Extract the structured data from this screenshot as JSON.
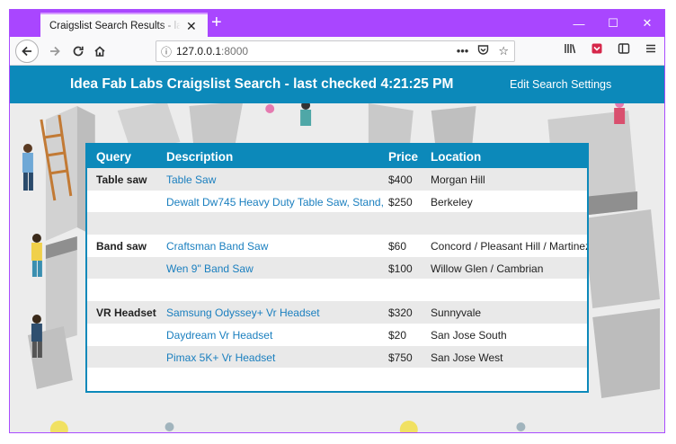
{
  "browser": {
    "tab_title": "Craigslist Search Results - last checked",
    "tab_close": "✕",
    "new_tab": "+",
    "url_host": "127.0.0.1",
    "url_port": ":8000",
    "window_controls": [
      "—",
      "☐",
      "✕"
    ]
  },
  "header": {
    "title": "Idea Fab Labs Craigslist Search - last checked 4:21:25 PM",
    "edit_link": "Edit Search Settings",
    "color": "#0c89ba"
  },
  "table": {
    "columns": [
      "Query",
      "Description",
      "Price",
      "Location"
    ],
    "rows": [
      {
        "query": "Table saw",
        "description": "Table Saw",
        "price": "$400",
        "location": "Morgan Hill"
      },
      {
        "query": "",
        "description": "Dewalt Dw745 Heavy Duty Table Saw, Stand,",
        "price": "$250",
        "location": "Berkeley"
      },
      {
        "query": "",
        "description": "",
        "price": "",
        "location": ""
      },
      {
        "query": "Band saw",
        "description": "Craftsman Band Saw",
        "price": "$60",
        "location": "Concord / Pleasant Hill / Martinez"
      },
      {
        "query": "",
        "description": "Wen 9\" Band Saw",
        "price": "$100",
        "location": "Willow Glen / Cambrian"
      },
      {
        "query": "",
        "description": "",
        "price": "",
        "location": ""
      },
      {
        "query": "VR Headset",
        "description": "Samsung Odyssey+ Vr Headset",
        "price": "$320",
        "location": "Sunnyvale"
      },
      {
        "query": "",
        "description": "Daydream Vr Headset",
        "price": "$20",
        "location": "San Jose South"
      },
      {
        "query": "",
        "description": "Pimax 5K+ Vr Headset",
        "price": "$750",
        "location": "San Jose West"
      },
      {
        "query": "",
        "description": "",
        "price": "",
        "location": ""
      }
    ]
  },
  "icons": {
    "back": "back-arrow-icon",
    "forward": "forward-arrow-icon",
    "reload": "reload-icon",
    "home": "home-icon",
    "info": "info-icon",
    "more": "more-icon",
    "pocket": "pocket-icon",
    "bookmark": "bookmark-star-icon",
    "library": "library-icon",
    "sidebar": "sidebar-icon",
    "menu": "hamburger-menu-icon"
  },
  "accent_color": "#a946ff"
}
